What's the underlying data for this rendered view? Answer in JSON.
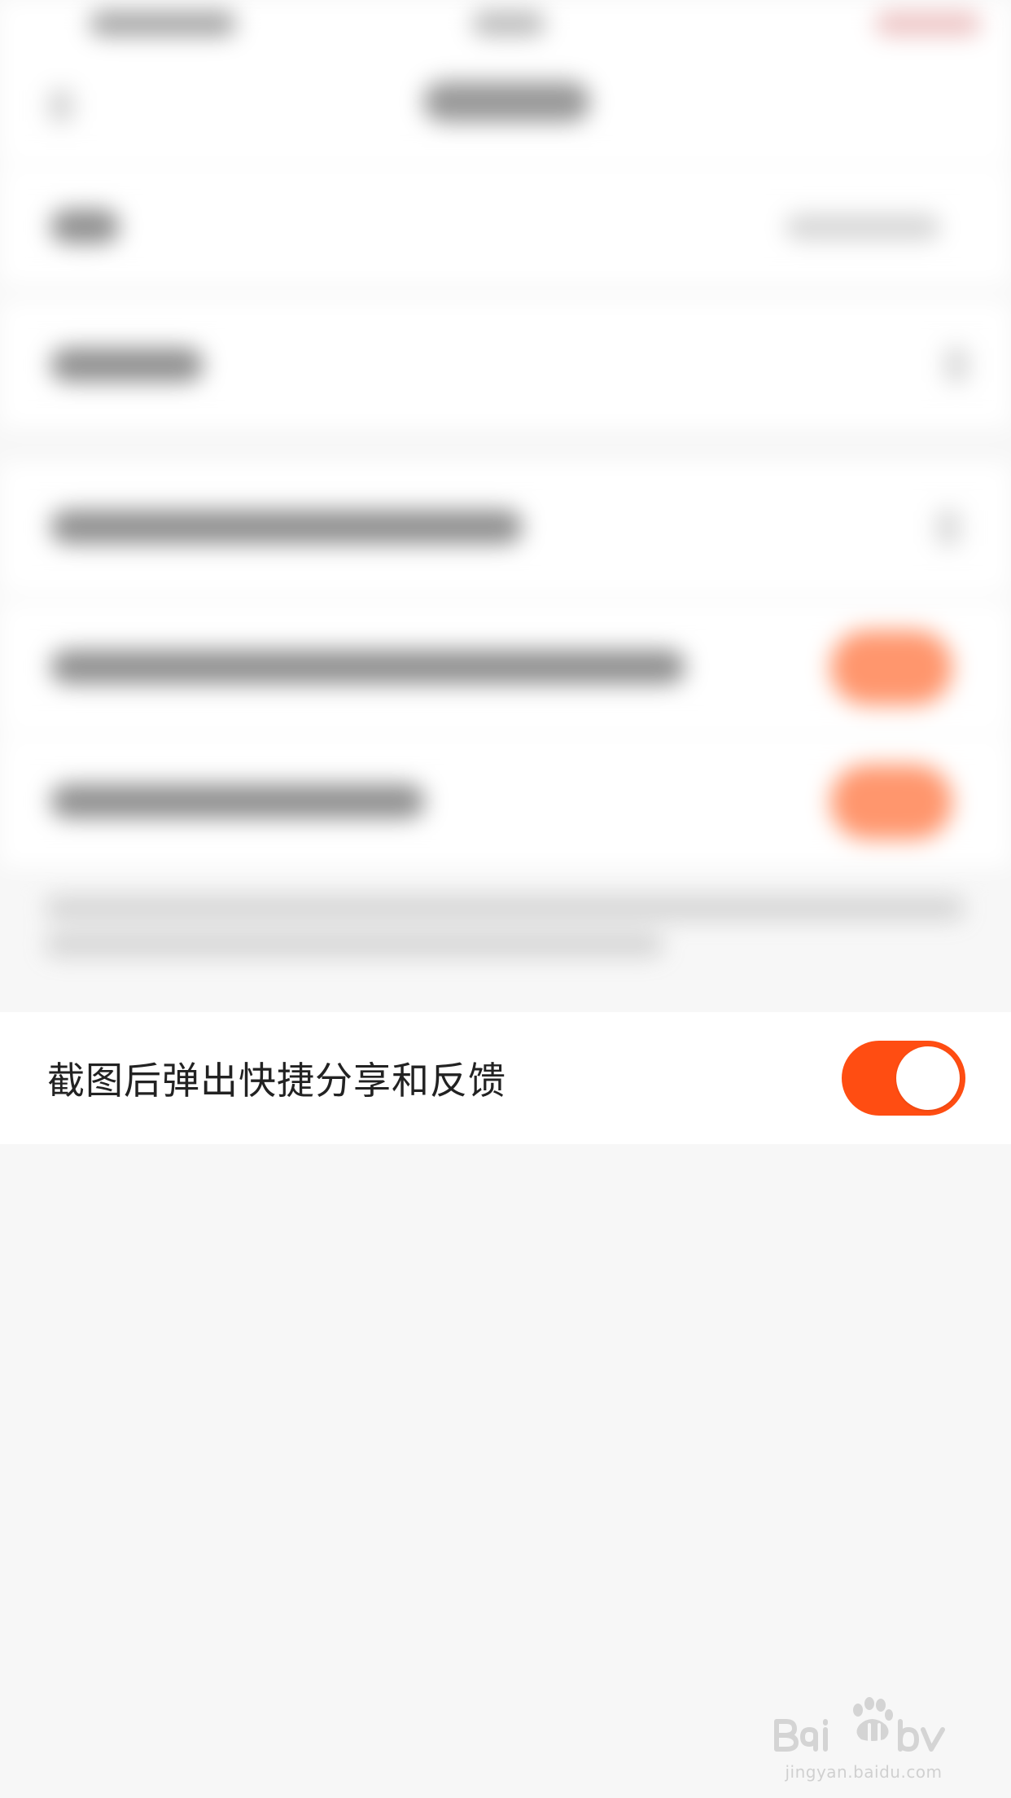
{
  "setting": {
    "label": "截图后弹出快捷分享和反馈",
    "enabled": true
  },
  "colors": {
    "accent": "#ff4d12",
    "row_background": "#ffffff",
    "page_background": "#f7f7f7",
    "label_text": "#222222"
  },
  "watermark": {
    "logo": "Baidu经验",
    "url": "jingyan.baidu.com"
  }
}
